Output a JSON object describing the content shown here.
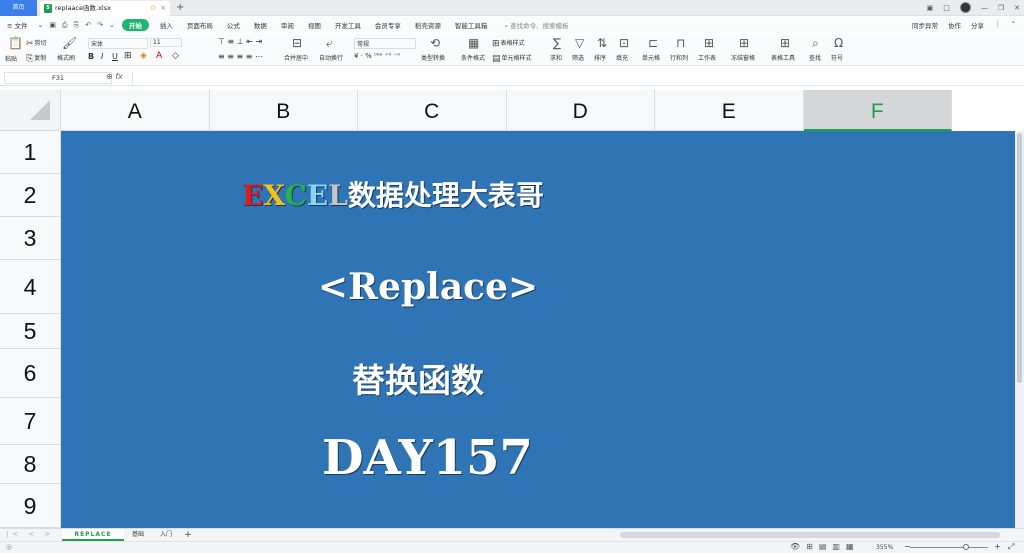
{
  "titlebar": {
    "home_tab": "首页",
    "doc_tab": "replaace函数.xlsx",
    "xls_badge": "S",
    "warn_icon": "⊙",
    "close_icon": "×",
    "new_tab_icon": "+",
    "win": [
      "▣",
      "□",
      "—",
      "❐",
      "✕"
    ]
  },
  "menubar": {
    "file": "≡ 文件",
    "qa_icons": [
      "⌄",
      "▣",
      "⎙",
      "⎘",
      "↶",
      "↷",
      "⌄"
    ],
    "start": "开始",
    "items": [
      "插入",
      "页面布局",
      "公式",
      "数据",
      "审阅",
      "视图",
      "开发工具",
      "会员专享",
      "稻壳资源",
      "智能工具箱"
    ],
    "search": "查找命令、搜索模板",
    "right": [
      "同步异常",
      "协作",
      "分享",
      "⋮",
      "⌃"
    ]
  },
  "ribbon": {
    "paste": "粘贴",
    "cut": "剪切",
    "copy": "复制",
    "format_painter": "格式刷",
    "font_name": "宋体",
    "font_size": "11",
    "bold": "B",
    "italic": "I",
    "underline": "U",
    "merge": "合并居中",
    "wrap": "自动换行",
    "number_format": "常规",
    "type_convert": "类型转换",
    "conditional": "条件格式",
    "table_style": "表格样式",
    "cell_style": "单元格样式",
    "sum": "求和",
    "filter": "筛选",
    "sort": "排序",
    "fill": "填充",
    "cell": "单元格",
    "row_col": "行和列",
    "worksheet": "工作表",
    "freeze": "冻结窗格",
    "table_tools": "表格工具",
    "find": "查找",
    "symbol": "符号"
  },
  "formula": {
    "cell_ref": "F31",
    "fx": "fx",
    "zoom_icon": "⊕"
  },
  "columns": [
    "A",
    "B",
    "C",
    "D",
    "E",
    "F"
  ],
  "selected_column": "F",
  "rows": [
    "1",
    "2",
    "3",
    "4",
    "5",
    "6",
    "7",
    "8",
    "9"
  ],
  "banner": {
    "excel_letters": [
      "E",
      "X",
      "C",
      "E",
      "L"
    ],
    "title_suffix": "数据处理大表哥",
    "subtitle": "<Replace>",
    "chinese": "替换函数",
    "day": "DAY157",
    "colors": {
      "background": "#2f74b5",
      "E": "#e01b1b",
      "X": "#f2c21a",
      "C": "#26b34a",
      "E2": "#8bd4f0",
      "L": "#c7c7c7"
    }
  },
  "sheets": [
    {
      "name": "REPLACE",
      "active": true
    },
    {
      "name": "基础",
      "active": false
    },
    {
      "name": "入门",
      "active": false
    }
  ],
  "sheet_nav": "|< < > >|",
  "add_sheet": "+",
  "status": {
    "zoom": "355%",
    "zoom_level": 0.72,
    "zoom_minus": "−",
    "zoom_plus": "+",
    "view_icons": [
      "👁",
      "⊞",
      "▤",
      "▥",
      "▦"
    ],
    "fit_icon": "⤢"
  }
}
